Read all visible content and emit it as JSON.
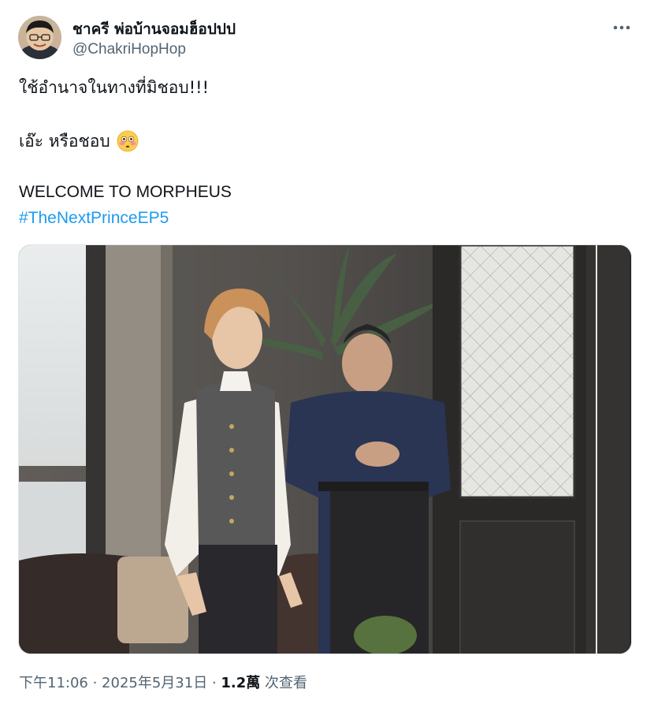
{
  "author": {
    "display_name": "ชาครี พ่อบ้านจอมฮ็อปปป",
    "handle": "@ChakriHopHop",
    "avatar_icon": "profile-photo"
  },
  "more_icon": "more-horizontal-icon",
  "tweet": {
    "line1": "ใช้อำนาจในทางที่มิชอบ!!!",
    "line2": "เอ๊ะ หรือชอบ",
    "line2_emoji": "flushed-face-emoji",
    "line3": "WELCOME TO MORPHEUS",
    "hashtag": "#TheNextPrinceEP5"
  },
  "media": {
    "type": "photo"
  },
  "meta": {
    "time": "下午11:06",
    "separator1": " · ",
    "date": "2025年5月31日",
    "separator2": " · ",
    "views": "1.2萬",
    "views_label": " 次查看"
  },
  "colors": {
    "link": "#1d9bf0",
    "secondary_text": "#536471",
    "primary_text": "#0f1419"
  }
}
